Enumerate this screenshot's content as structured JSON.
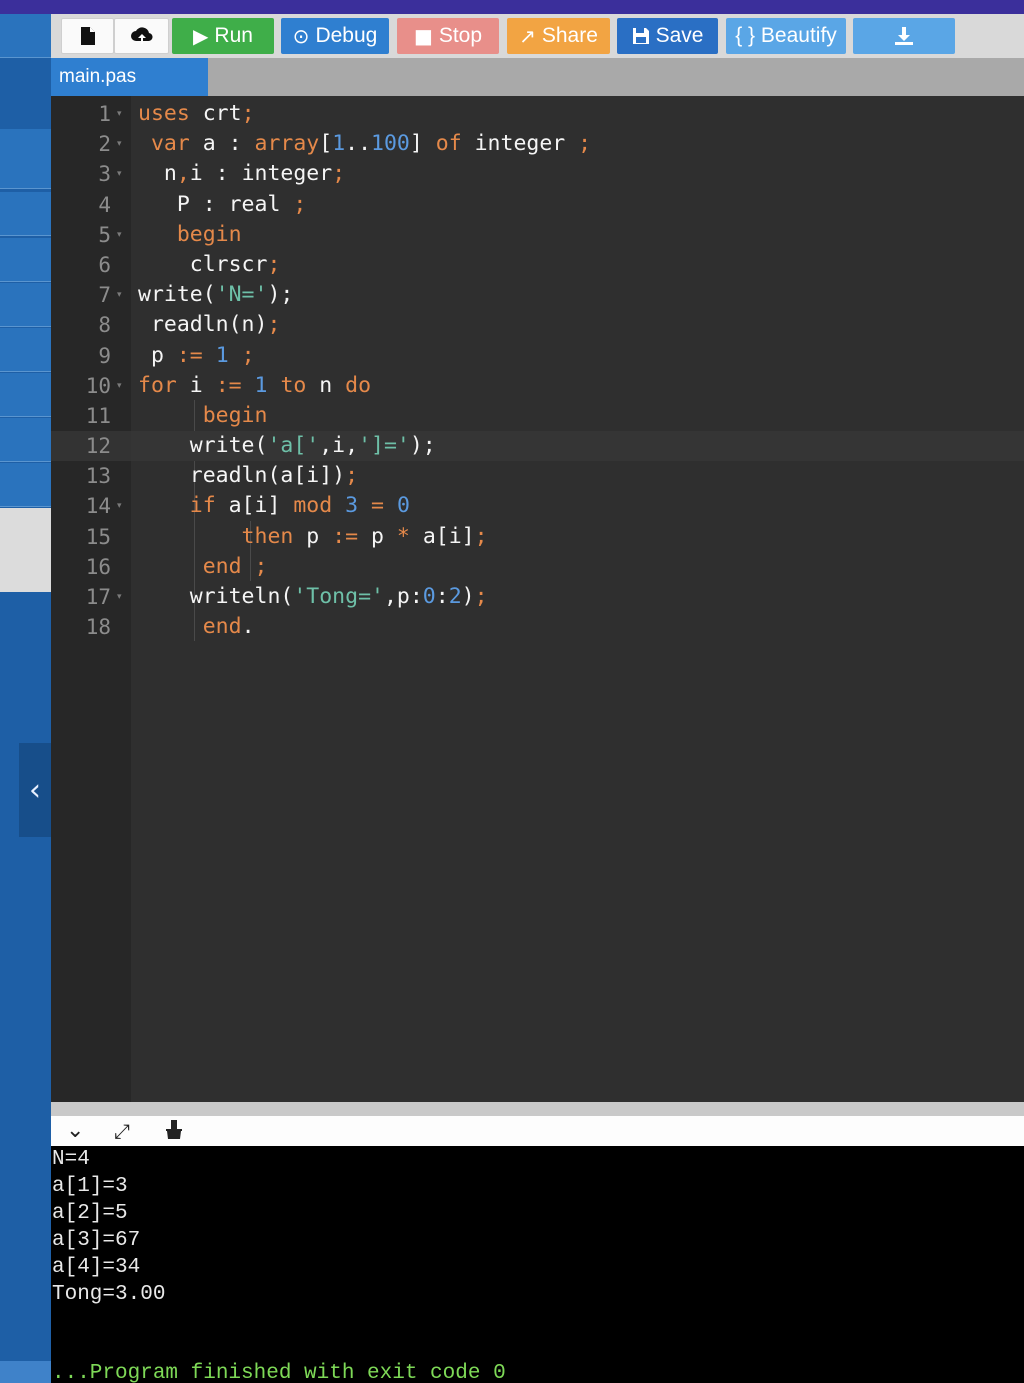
{
  "toolbar": {
    "new_icon": "file-icon",
    "upload_icon": "upload-icon",
    "run_label": "Run",
    "debug_label": "Debug",
    "stop_label": "Stop",
    "share_label": "Share",
    "save_label": "Save",
    "beautify_label": "{ } Beautify",
    "download_icon": "download-icon"
  },
  "file_tab": {
    "name": "main.pas"
  },
  "editor": {
    "active_line": 12,
    "lines": [
      {
        "num": "1",
        "fold": true
      },
      {
        "num": "2",
        "fold": true
      },
      {
        "num": "3",
        "fold": true
      },
      {
        "num": "4",
        "fold": false
      },
      {
        "num": "5",
        "fold": true
      },
      {
        "num": "6",
        "fold": false
      },
      {
        "num": "7",
        "fold": true
      },
      {
        "num": "8",
        "fold": false
      },
      {
        "num": "9",
        "fold": false
      },
      {
        "num": "10",
        "fold": true
      },
      {
        "num": "11",
        "fold": false
      },
      {
        "num": "12",
        "fold": false
      },
      {
        "num": "13",
        "fold": false
      },
      {
        "num": "14",
        "fold": true
      },
      {
        "num": "15",
        "fold": false
      },
      {
        "num": "16",
        "fold": false
      },
      {
        "num": "17",
        "fold": true
      },
      {
        "num": "18",
        "fold": false
      }
    ],
    "code": {
      "l1": [
        "uses",
        " crt",
        ";"
      ],
      "l2": [
        " var",
        " a : ",
        "array",
        "[",
        "1",
        "..",
        "100",
        "] ",
        "of",
        " integer ",
        ";"
      ],
      "l3": [
        "  n",
        ",",
        "i : integer",
        ";"
      ],
      "l4": [
        "   P : real ",
        ";"
      ],
      "l5": [
        "   begin"
      ],
      "l6": [
        "    clrscr",
        ";"
      ],
      "l7": [
        "write(",
        "'N='",
        ");"
      ],
      "l8": [
        " readln(n)",
        ";"
      ],
      "l9": [
        " p ",
        ":=",
        " ",
        "1",
        " ",
        ";"
      ],
      "l10": [
        "for",
        " i ",
        ":=",
        " ",
        "1",
        " ",
        "to",
        " n ",
        "do"
      ],
      "l11": [
        "     begin"
      ],
      "l12": [
        "    write(",
        "'a['",
        ",i,",
        "']='",
        ");"
      ],
      "l13": [
        "    readln(a[i])",
        ";"
      ],
      "l14": [
        "    if",
        " a[i] ",
        "mod",
        " ",
        "3",
        " ",
        "=",
        " ",
        "0"
      ],
      "l15": [
        "        then",
        " p ",
        ":=",
        " p ",
        "*",
        " a[i]",
        ";"
      ],
      "l16": [
        "     end",
        " ;"
      ],
      "l17": [
        "    writeln(",
        "'Tong='",
        ",p:",
        "0",
        ":",
        "2",
        ")",
        ";"
      ],
      "l18": [
        "     end",
        "."
      ]
    }
  },
  "console_bar": {
    "collapse_icon": "chevron-down-icon",
    "expand_icon": "expand-icon",
    "clear_icon": "clear-console-icon"
  },
  "console": {
    "output": [
      "N=4",
      "a[1]=3",
      "a[2]=5",
      "a[3]=67",
      "a[4]=34",
      "Tong=3.00"
    ],
    "finish": "...Program finished with exit code 0"
  },
  "sidebar": {
    "collapse_icon": "chevron-left-icon"
  },
  "colors": {
    "keyword": "#e5894a",
    "string": "#6ec0a8",
    "number": "#5b9ae0",
    "run": "#3fae49",
    "debug": "#2f7fd0",
    "stop": "#e88f8a",
    "share": "#f2a443",
    "save": "#2a6fc4",
    "beautify": "#5aa6e6"
  }
}
